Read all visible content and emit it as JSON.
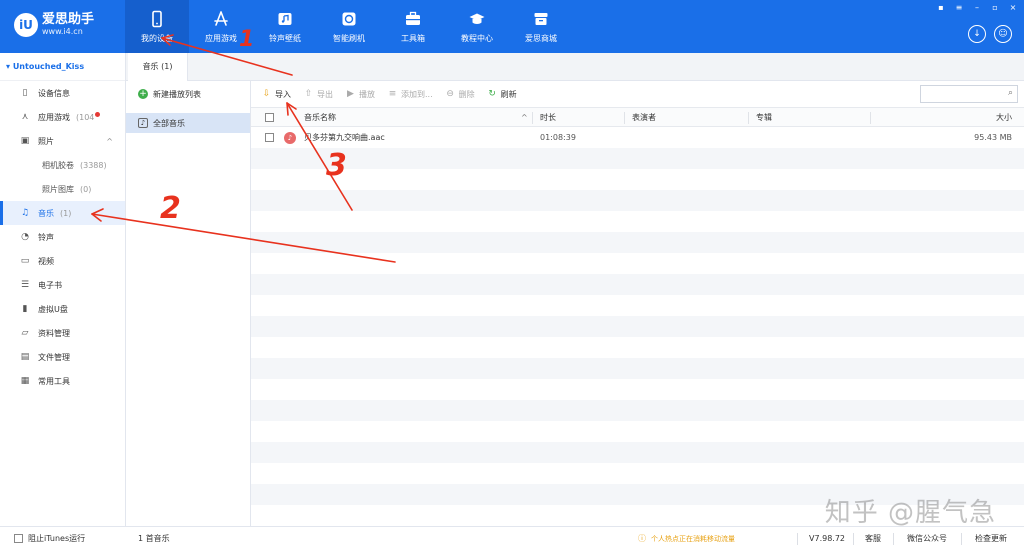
{
  "app": {
    "name": "爱思助手",
    "url": "www.i4.cn",
    "logo_letter": "iU"
  },
  "nav": [
    {
      "label": "我的设备",
      "icon": "phone-icon",
      "active": true
    },
    {
      "label": "应用游戏",
      "icon": "app-store-icon"
    },
    {
      "label": "铃声壁纸",
      "icon": "ringtone-wallpaper-icon"
    },
    {
      "label": "智能刷机",
      "icon": "flash-icon"
    },
    {
      "label": "工具箱",
      "icon": "toolbox-icon"
    },
    {
      "label": "教程中心",
      "icon": "tutorial-icon"
    },
    {
      "label": "爱思商城",
      "icon": "store-icon"
    }
  ],
  "window_controls": [
    "▪",
    "≡",
    "–",
    "▫",
    "×"
  ],
  "device": {
    "name": "Untouched_Kiss"
  },
  "sidebar": [
    {
      "label": "设备信息",
      "icon": "device-info-icon",
      "glyph": "▯"
    },
    {
      "label": "应用游戏",
      "count": "(104",
      "icon": "apps-icon",
      "glyph": "⋏",
      "badge": true
    },
    {
      "label": "照片",
      "icon": "photo-icon",
      "glyph": "▣",
      "expand": "^"
    },
    {
      "label": "相机胶卷",
      "count": "(3388)",
      "sub": true
    },
    {
      "label": "照片图库",
      "count": "(0)",
      "sub": true
    },
    {
      "label": "音乐",
      "count": "(1)",
      "icon": "music-note-icon",
      "glyph": "♫",
      "active": true
    },
    {
      "label": "铃声",
      "icon": "bell-icon",
      "glyph": "◔"
    },
    {
      "label": "视频",
      "icon": "video-icon",
      "glyph": "▭"
    },
    {
      "label": "电子书",
      "icon": "ebook-icon",
      "glyph": "☰"
    },
    {
      "label": "虚拟U盘",
      "icon": "usb-drive-icon",
      "glyph": "▮"
    },
    {
      "label": "资料管理",
      "icon": "folder-icon",
      "glyph": "▱"
    },
    {
      "label": "文件管理",
      "icon": "file-icon",
      "glyph": "▤"
    },
    {
      "label": "常用工具",
      "icon": "tools-grid-icon",
      "glyph": "▦"
    }
  ],
  "tab": {
    "label": "音乐 (1)"
  },
  "playlists": {
    "new_label": "新建播放列表",
    "all_label": "全部音乐"
  },
  "toolbar": [
    {
      "label": "导入",
      "icon": "import-icon",
      "glyph": "⇩",
      "enabled": true
    },
    {
      "label": "导出",
      "icon": "export-icon",
      "glyph": "⇧",
      "enabled": false
    },
    {
      "label": "播放",
      "icon": "play-icon",
      "glyph": "▶",
      "enabled": false
    },
    {
      "label": "添加到...",
      "icon": "add-to-icon",
      "glyph": "≡",
      "enabled": false
    },
    {
      "label": "删除",
      "icon": "delete-icon",
      "glyph": "⊖",
      "enabled": false
    },
    {
      "label": "刷新",
      "icon": "refresh-icon",
      "glyph": "↻",
      "enabled": true
    }
  ],
  "table": {
    "headers": {
      "name": "音乐名称",
      "duration": "时长",
      "artist": "表演者",
      "album": "专辑",
      "size": "大小"
    },
    "sort_glyph": "^",
    "rows": [
      {
        "name": "贝多芬第九交响曲.aac",
        "duration": "01:08:39",
        "artist": "",
        "album": "",
        "size": "95.43 MB"
      }
    ]
  },
  "status": {
    "itunes_label": "阻止iTunes运行",
    "count_label": "1 首音乐",
    "notice": "个人热点正在消耗移动流量",
    "version": "V7.98.72",
    "service": "客服",
    "wechat": "微信公众号",
    "update": "检查更新"
  },
  "watermark": "知乎 @腥气急",
  "annotations": {
    "n1": "1",
    "n2": "2",
    "n3": "3",
    "color": "#e8321e"
  },
  "colors": {
    "brand": "#1a6fe8",
    "accent_green": "#3fae4b"
  }
}
